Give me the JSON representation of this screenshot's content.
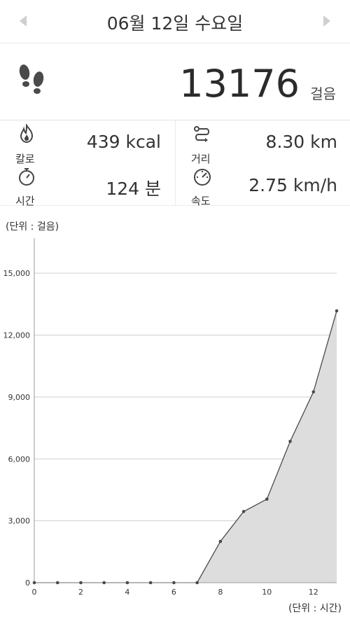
{
  "header": {
    "date": "06월 12일 수요일"
  },
  "steps": {
    "value": "13176",
    "unit": "걸음"
  },
  "stats": {
    "calories": {
      "label": "칼로",
      "value": "439 kcal"
    },
    "distance": {
      "label": "거리",
      "value": "8.30 km"
    },
    "time": {
      "label": "시간",
      "value": "124 분"
    },
    "speed": {
      "label": "속도",
      "value": "2.75 km/h"
    }
  },
  "chart_labels": {
    "y_unit": "(단위 : 걸음)",
    "x_unit": "(단위 : 시간)"
  },
  "chart_data": {
    "type": "area",
    "title": "",
    "xlabel": "(단위 : 시간)",
    "ylabel": "(단위 : 걸음)",
    "x": [
      0,
      1,
      2,
      3,
      4,
      5,
      6,
      7,
      8,
      9,
      10,
      11,
      12,
      13
    ],
    "values": [
      0,
      0,
      0,
      0,
      0,
      0,
      0,
      0,
      2000,
      3450,
      4050,
      6850,
      9250,
      13176
    ],
    "xlim": [
      0,
      13
    ],
    "ylim": [
      0,
      16500
    ],
    "x_ticks": [
      "0",
      "2",
      "4",
      "6",
      "8",
      "10",
      "12"
    ],
    "y_ticks": [
      "0",
      "3,000",
      "6,000",
      "9,000",
      "12,000",
      "15,000"
    ],
    "grid": true,
    "fill_color": "#dddddd",
    "line_color": "#4a4a4a"
  }
}
